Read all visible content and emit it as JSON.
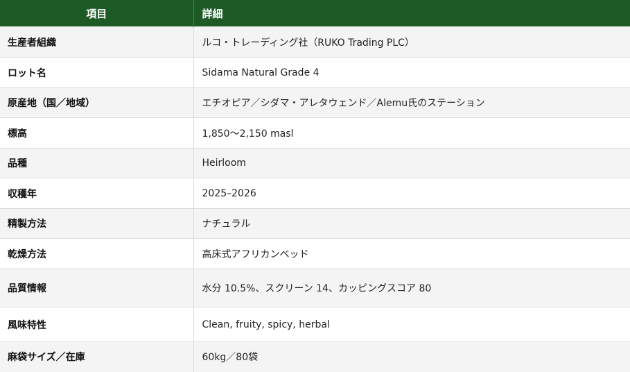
{
  "header": {
    "col1": "項目",
    "col2": "詳細"
  },
  "rows": [
    {
      "label": "生産者組織",
      "value": "ルコ・トレーディング社（RUKO Trading PLC）"
    },
    {
      "label": "ロット名",
      "value": "Sidama Natural Grade 4"
    },
    {
      "label": "原産地（国／地域）",
      "value": "エチオピア／シダマ・アレタウェンド／Alemu氏のステーション"
    },
    {
      "label": "標高",
      "value": "1,850〜2,150 masl"
    },
    {
      "label": "品種",
      "value": "Heirloom"
    },
    {
      "label": "収穫年",
      "value": "2025–2026"
    },
    {
      "label": "精製方法",
      "value": "ナチュラル"
    },
    {
      "label": "乾燥方法",
      "value": "高床式アフリカンベッド"
    },
    {
      "label": "品質情報",
      "value": "水分 10.5%、スクリーン 14、カッピングスコア 80"
    },
    {
      "label": "風味特性",
      "value": "Clean, fruity, spicy, herbal"
    },
    {
      "label": "麻袋サイズ／在庫",
      "value": "60kg／80袋"
    }
  ]
}
